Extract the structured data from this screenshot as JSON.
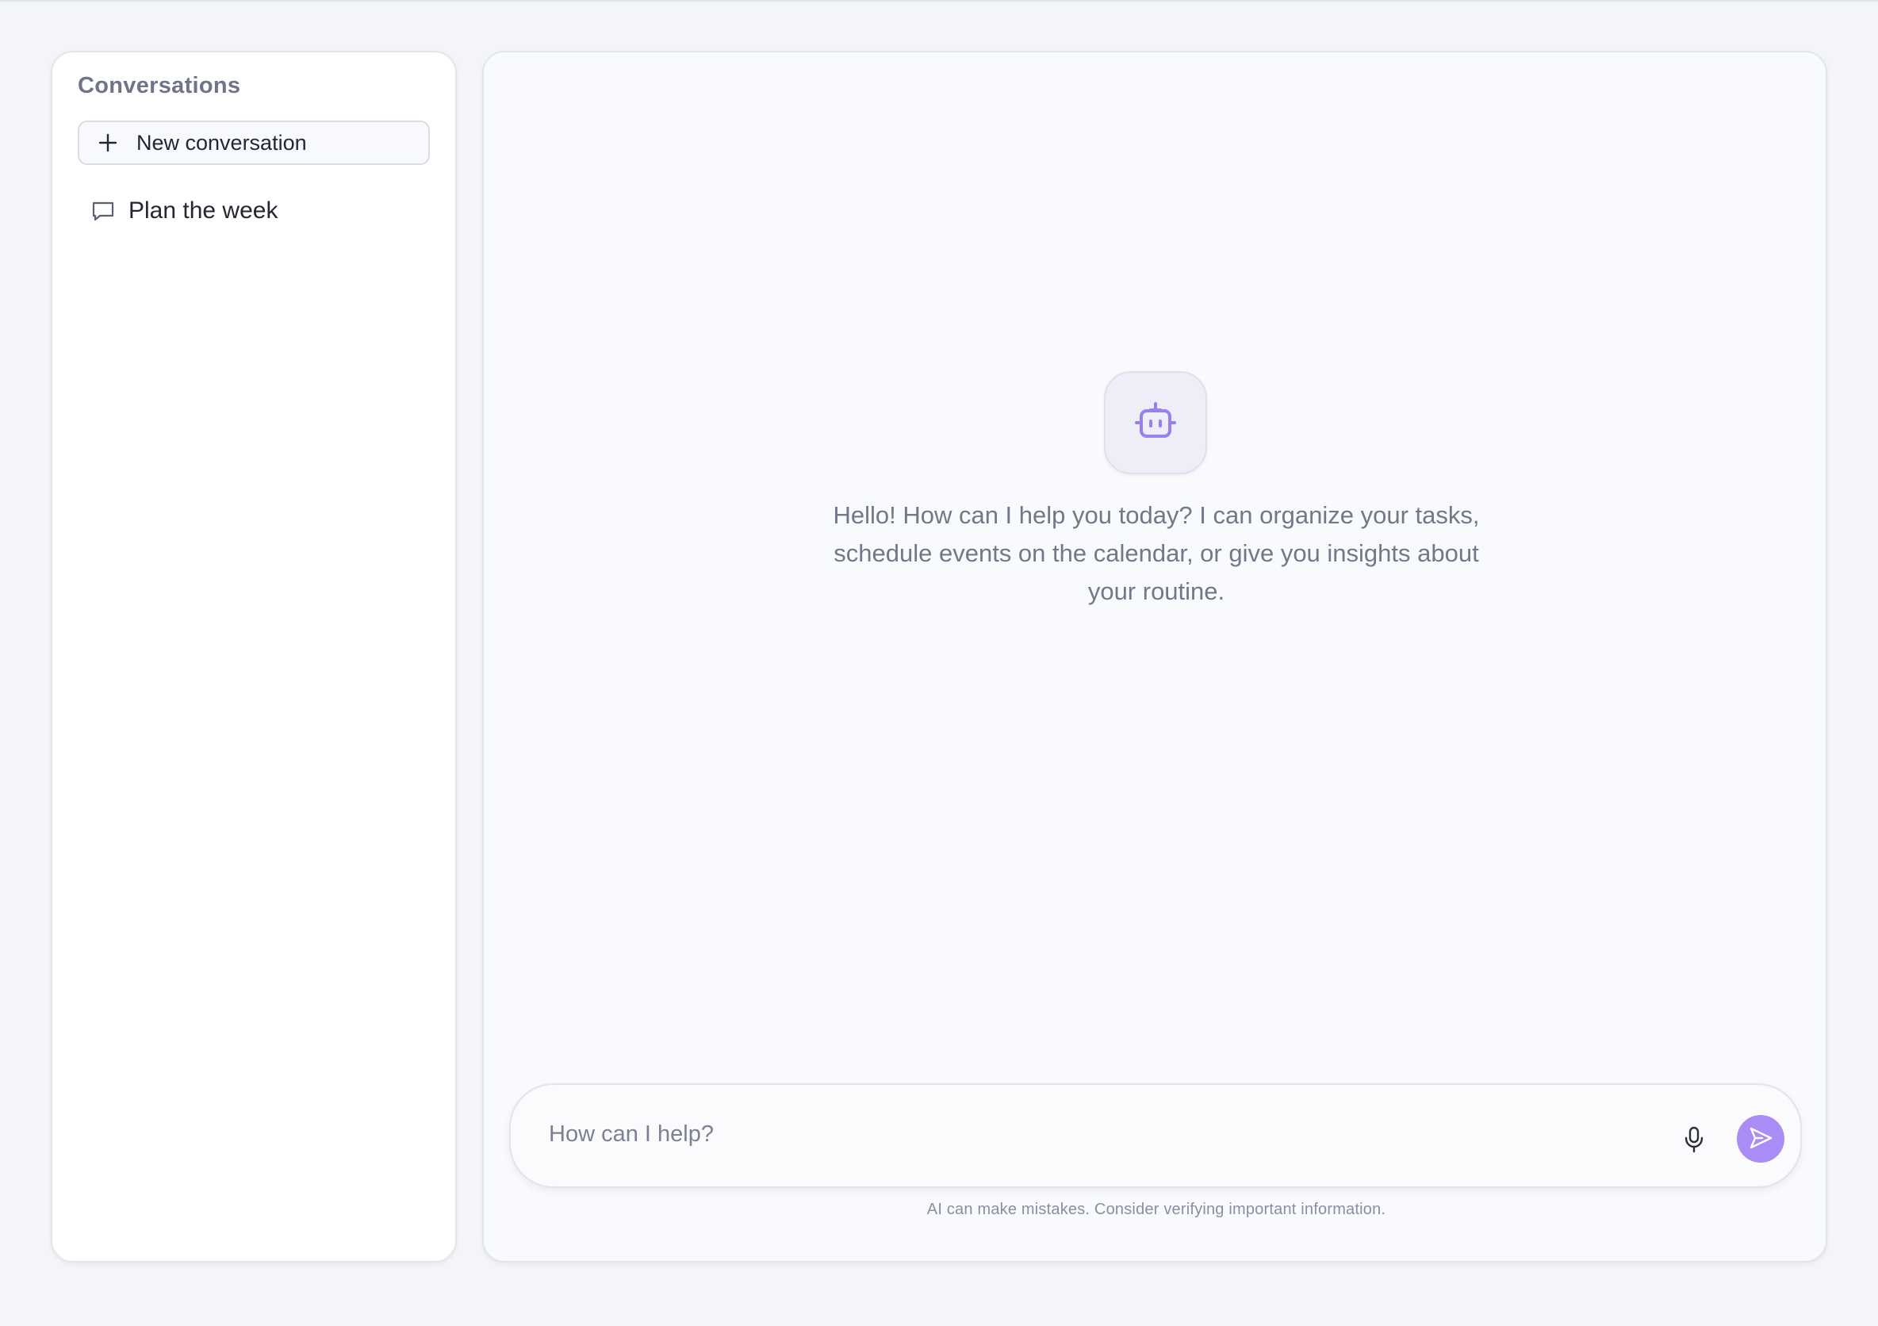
{
  "sidebar": {
    "title": "Conversations",
    "new_button_label": "New conversation",
    "items": [
      {
        "label": "Plan the week"
      }
    ]
  },
  "main": {
    "greeting": "Hello! How can I help you today? I can organize your tasks, schedule events on the calendar, or give you insights about your routine.",
    "assistant_icon": "bot-icon",
    "composer": {
      "placeholder": "How can I help?",
      "value": "",
      "mic_icon": "microphone-icon",
      "send_icon": "send-icon"
    },
    "disclaimer": "AI can make mistakes. Consider verifying important information."
  },
  "colors": {
    "accent": "#a98cf5",
    "bot_icon": "#9b7ff0",
    "background": "#f4f5f9"
  }
}
